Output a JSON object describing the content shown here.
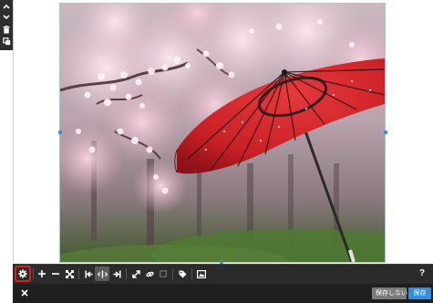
{
  "editor": {
    "side_tools": [
      {
        "icon": "chevron-up-icon"
      },
      {
        "icon": "chevron-down-icon"
      },
      {
        "icon": "trash-icon"
      },
      {
        "icon": "copy-icon"
      }
    ],
    "image": {
      "subject": "red-umbrella-cherry-blossoms"
    }
  },
  "toolbar": {
    "tools": [
      {
        "icon": "gear-icon",
        "state": "selected"
      },
      {
        "icon": "plus-icon"
      },
      {
        "icon": "minus-icon"
      },
      {
        "icon": "fit-icon"
      },
      {
        "icon": "align-left-icon"
      },
      {
        "icon": "align-center-icon",
        "state": "active"
      },
      {
        "icon": "align-right-icon"
      },
      {
        "icon": "resize-icon"
      },
      {
        "icon": "link-icon"
      },
      {
        "icon": "crop-icon",
        "state": "disabled"
      },
      {
        "icon": "tag-icon"
      },
      {
        "icon": "image-icon"
      },
      {
        "icon": "help-icon"
      }
    ],
    "help_label": "?"
  },
  "footer": {
    "close_icon": "close-icon",
    "no_save_label": "保存しない",
    "save_label": "保存"
  },
  "colors": {
    "toolbar_bg": "#2b2b2b",
    "footer_bg": "#1f1f1f",
    "save_accent": "#2f8fe0",
    "selection": "#3a8fd8",
    "selected_outline": "#d42020"
  }
}
